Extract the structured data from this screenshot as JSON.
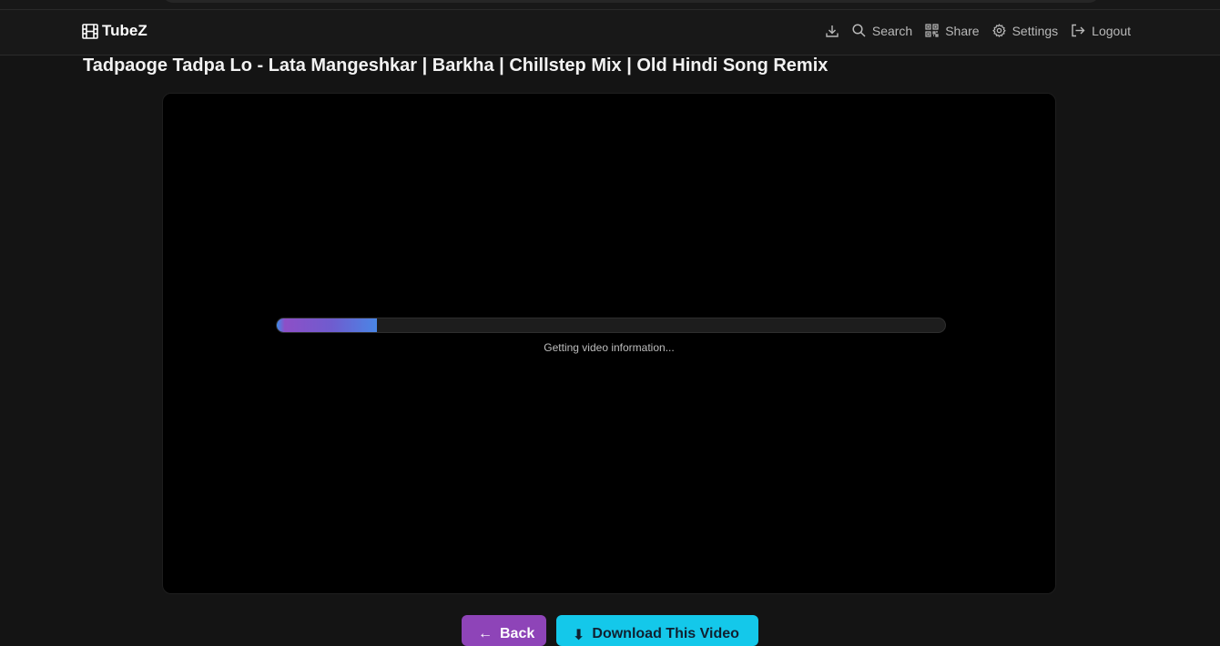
{
  "app": {
    "name": "TubeZ",
    "logo_icon": "film-icon"
  },
  "nav": {
    "items": [
      {
        "label": "",
        "icon": "download-icon"
      },
      {
        "label": "Search",
        "icon": "search-icon"
      },
      {
        "label": "Share",
        "icon": "qr-code-icon"
      },
      {
        "label": "Settings",
        "icon": "gear-icon"
      },
      {
        "label": "Logout",
        "icon": "logout-icon"
      }
    ]
  },
  "video": {
    "title": "Tadpaoge Tadpa Lo - Lata Mangeshkar | Barkha | Chillstep Mix | Old Hindi Song Remix"
  },
  "loader": {
    "progress_fraction": 0.15,
    "status": "Getting video information..."
  },
  "actions": {
    "back_label": "Back",
    "back_icon": "arrow-left-icon",
    "download_label": "Download This Video",
    "download_icon": "download-icon"
  },
  "colors": {
    "background": "#141414",
    "navbar": "#181818",
    "player": "#000000",
    "back_button": "#8e44b8",
    "download_button": "#14c8ea",
    "progress_start": "#3d8be8",
    "progress_mid": "#8d4fc7"
  }
}
